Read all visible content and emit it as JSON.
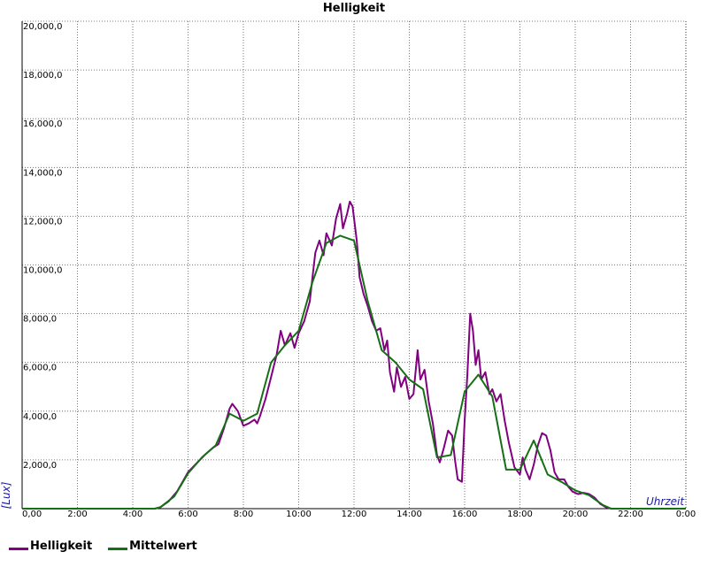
{
  "chart_data": {
    "type": "line",
    "title": "Helligkeit",
    "xlabel": "Uhrzeit",
    "ylabel": "[Lux]",
    "x_ticks": [
      "0,00",
      "2:00",
      "4:00",
      "6:00",
      "8:00",
      "10:00",
      "12:00",
      "14:00",
      "16:00",
      "18:00",
      "20:00",
      "22:00",
      "0:00"
    ],
    "y_ticks": [
      "2,000,0",
      "4,000,0",
      "6,000,0",
      "8,000,0",
      "10,000,0",
      "12,000,0",
      "14,000,0",
      "16,000,0",
      "18,000,0",
      "20,000,0"
    ],
    "xlim": [
      0,
      24
    ],
    "ylim": [
      0,
      20000
    ],
    "grid": true,
    "legend_position": "bottom-left",
    "series": [
      {
        "name": "Helligkeit",
        "color": "#800080",
        "points": [
          [
            0,
            0
          ],
          [
            4.8,
            0
          ],
          [
            5.0,
            60
          ],
          [
            5.3,
            300
          ],
          [
            5.6,
            700
          ],
          [
            5.8,
            1100
          ],
          [
            6.0,
            1500
          ],
          [
            6.3,
            1850
          ],
          [
            6.6,
            2200
          ],
          [
            6.9,
            2500
          ],
          [
            7.1,
            2650
          ],
          [
            7.3,
            3300
          ],
          [
            7.5,
            4100
          ],
          [
            7.6,
            4300
          ],
          [
            7.8,
            4000
          ],
          [
            7.9,
            3700
          ],
          [
            8.0,
            3400
          ],
          [
            8.2,
            3500
          ],
          [
            8.4,
            3650
          ],
          [
            8.5,
            3500
          ],
          [
            8.6,
            3800
          ],
          [
            8.8,
            4500
          ],
          [
            9.0,
            5400
          ],
          [
            9.2,
            6300
          ],
          [
            9.35,
            7300
          ],
          [
            9.5,
            6700
          ],
          [
            9.7,
            7200
          ],
          [
            9.85,
            6600
          ],
          [
            10.0,
            7200
          ],
          [
            10.2,
            7700
          ],
          [
            10.4,
            8500
          ],
          [
            10.5,
            9500
          ],
          [
            10.6,
            10500
          ],
          [
            10.75,
            11000
          ],
          [
            10.9,
            10400
          ],
          [
            11.0,
            11300
          ],
          [
            11.2,
            10800
          ],
          [
            11.35,
            11900
          ],
          [
            11.5,
            12500
          ],
          [
            11.6,
            11500
          ],
          [
            11.75,
            12100
          ],
          [
            11.85,
            12600
          ],
          [
            11.95,
            12400
          ],
          [
            12.1,
            11000
          ],
          [
            12.2,
            9500
          ],
          [
            12.35,
            8800
          ],
          [
            12.5,
            8300
          ],
          [
            12.65,
            7700
          ],
          [
            12.8,
            7300
          ],
          [
            12.95,
            7400
          ],
          [
            13.1,
            6500
          ],
          [
            13.2,
            6900
          ],
          [
            13.3,
            5600
          ],
          [
            13.45,
            4800
          ],
          [
            13.55,
            5800
          ],
          [
            13.7,
            5000
          ],
          [
            13.85,
            5400
          ],
          [
            14.0,
            4500
          ],
          [
            14.15,
            4700
          ],
          [
            14.3,
            6500
          ],
          [
            14.4,
            5300
          ],
          [
            14.55,
            5700
          ],
          [
            14.7,
            4400
          ],
          [
            14.85,
            3500
          ],
          [
            15.0,
            2200
          ],
          [
            15.1,
            1900
          ],
          [
            15.25,
            2500
          ],
          [
            15.4,
            3200
          ],
          [
            15.55,
            3000
          ],
          [
            15.65,
            2000
          ],
          [
            15.75,
            1200
          ],
          [
            15.9,
            1100
          ],
          [
            16.0,
            3600
          ],
          [
            16.1,
            5500
          ],
          [
            16.2,
            8000
          ],
          [
            16.3,
            7300
          ],
          [
            16.4,
            5900
          ],
          [
            16.5,
            6500
          ],
          [
            16.6,
            5300
          ],
          [
            16.75,
            5600
          ],
          [
            16.9,
            4700
          ],
          [
            17.0,
            4900
          ],
          [
            17.15,
            4400
          ],
          [
            17.3,
            4700
          ],
          [
            17.45,
            3600
          ],
          [
            17.6,
            2700
          ],
          [
            17.8,
            1700
          ],
          [
            18.0,
            1400
          ],
          [
            18.1,
            2100
          ],
          [
            18.2,
            1600
          ],
          [
            18.35,
            1200
          ],
          [
            18.5,
            1800
          ],
          [
            18.65,
            2600
          ],
          [
            18.8,
            3100
          ],
          [
            18.95,
            3000
          ],
          [
            19.1,
            2400
          ],
          [
            19.25,
            1500
          ],
          [
            19.4,
            1200
          ],
          [
            19.6,
            1200
          ],
          [
            19.75,
            900
          ],
          [
            19.9,
            700
          ],
          [
            20.1,
            600
          ],
          [
            20.3,
            650
          ],
          [
            20.5,
            600
          ],
          [
            20.7,
            450
          ],
          [
            20.9,
            200
          ],
          [
            21.1,
            60
          ],
          [
            21.3,
            0
          ],
          [
            24,
            0
          ]
        ]
      },
      {
        "name": "Mittelwert",
        "color": "#157015",
        "points": [
          [
            0,
            0
          ],
          [
            4.8,
            0
          ],
          [
            5.0,
            60
          ],
          [
            5.5,
            500
          ],
          [
            6.0,
            1450
          ],
          [
            6.5,
            2100
          ],
          [
            7.0,
            2600
          ],
          [
            7.5,
            3900
          ],
          [
            8.0,
            3600
          ],
          [
            8.5,
            3900
          ],
          [
            9.0,
            6000
          ],
          [
            9.5,
            6700
          ],
          [
            10.0,
            7300
          ],
          [
            10.5,
            9300
          ],
          [
            11.0,
            10900
          ],
          [
            11.5,
            11200
          ],
          [
            12.0,
            11000
          ],
          [
            12.5,
            8500
          ],
          [
            13.0,
            6500
          ],
          [
            13.5,
            6000
          ],
          [
            14.0,
            5300
          ],
          [
            14.5,
            4900
          ],
          [
            15.0,
            2100
          ],
          [
            15.5,
            2200
          ],
          [
            16.0,
            4800
          ],
          [
            16.5,
            5500
          ],
          [
            17.0,
            4600
          ],
          [
            17.5,
            1600
          ],
          [
            18.0,
            1600
          ],
          [
            18.5,
            2800
          ],
          [
            19.0,
            1400
          ],
          [
            19.5,
            1100
          ],
          [
            20.0,
            750
          ],
          [
            20.5,
            550
          ],
          [
            21.0,
            150
          ],
          [
            21.3,
            0
          ],
          [
            24,
            0
          ]
        ]
      }
    ]
  }
}
